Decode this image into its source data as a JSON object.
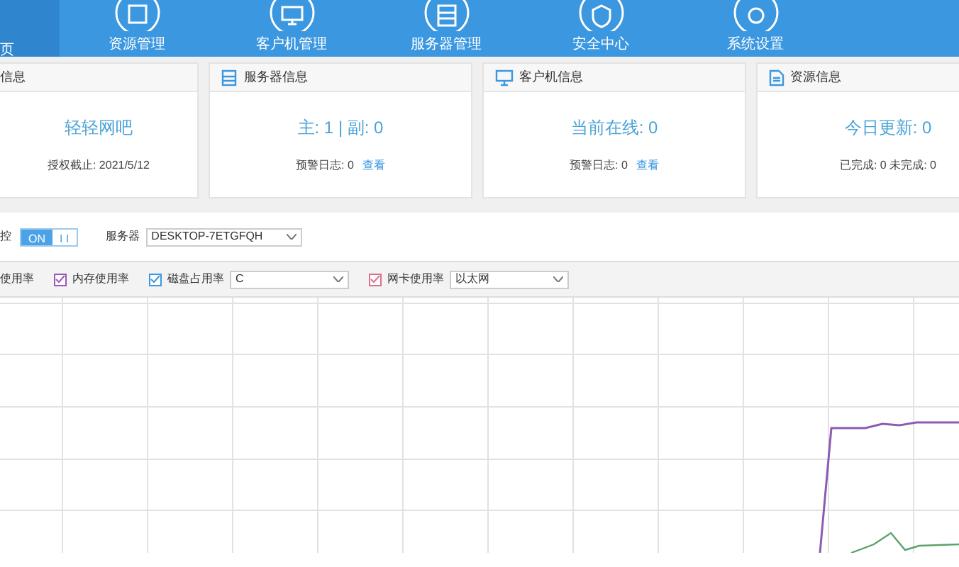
{
  "nav": [
    {
      "label": "页",
      "selected": true
    },
    {
      "label": "资源管理",
      "selected": false
    },
    {
      "label": "客户机管理",
      "selected": false
    },
    {
      "label": "服务器管理",
      "selected": false
    },
    {
      "label": "安全中心",
      "selected": false
    },
    {
      "label": "系统设置",
      "selected": false
    }
  ],
  "cards": [
    {
      "title": "信息",
      "main": "轻轻网吧",
      "sub": "授权截止: 2021/5/12"
    },
    {
      "title": "服务器信息",
      "main": "主: 1 | 副: 0",
      "sub": "预警日志: 0",
      "link": "查看"
    },
    {
      "title": "客户机信息",
      "main": "当前在线: 0",
      "sub": "预警日志: 0",
      "link": "查看"
    },
    {
      "title": "资源信息",
      "main": "今日更新: 0",
      "sub": "已完成: 0 未完成: 0"
    }
  ],
  "monitor": {
    "label": "控",
    "toggle": {
      "on_label": "ON",
      "off_label": "I I",
      "on": true
    },
    "server_label": "服务器",
    "server": "DESKTOP-7ETGFQH"
  },
  "metrics": [
    {
      "label": "使用率",
      "kind": "plain"
    },
    {
      "label": "内存使用率",
      "kind": "checkbox",
      "checked": true,
      "color": "#9b59b6"
    },
    {
      "label": "磁盘占用率",
      "kind": "checkbox",
      "checked": true,
      "color": "#3a97e0",
      "select": "C"
    },
    {
      "label": "网卡使用率",
      "kind": "checkbox",
      "checked": true,
      "color": "#d9708f",
      "select": "以太网"
    }
  ]
}
